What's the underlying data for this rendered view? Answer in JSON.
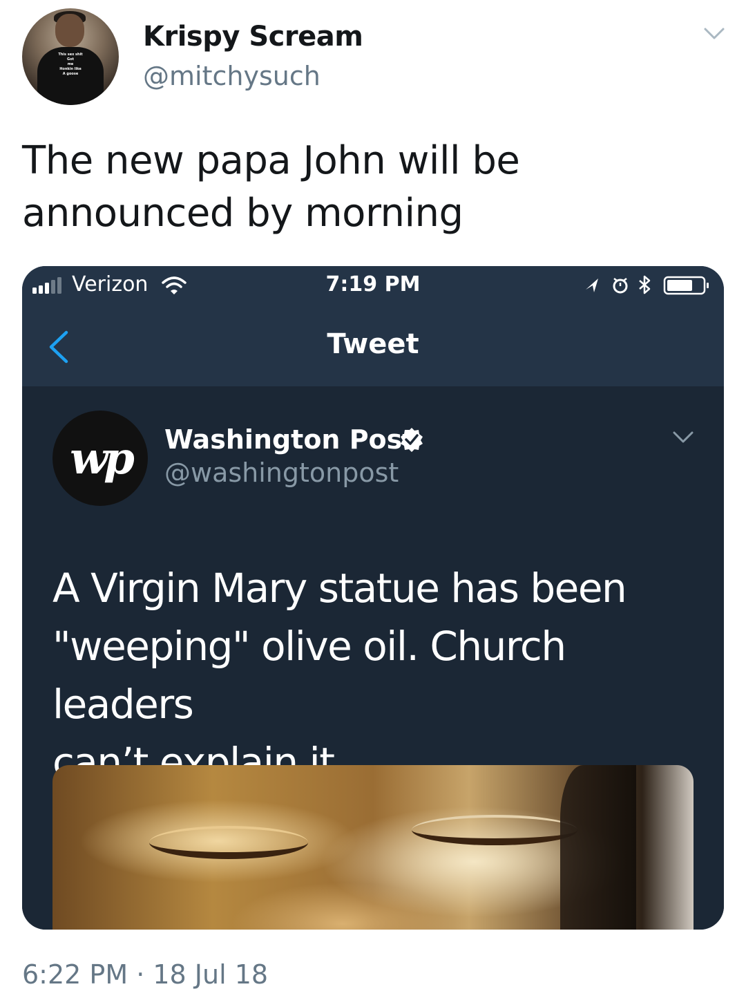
{
  "author": {
    "display_name": "Krispy Scream",
    "handle": "@mitchysuch",
    "avatar_shirt_text": [
      "This sex shit",
      "Got",
      "me",
      "Honkin like",
      "A goose"
    ]
  },
  "tweet": {
    "text_line1": "The new papa John will be",
    "text_line2": "announced by morning",
    "timestamp": "6:22 PM · 18 Jul 18"
  },
  "embedded_screenshot": {
    "status_bar": {
      "carrier": "Verizon",
      "time": "7:19 PM"
    },
    "nav": {
      "title": "Tweet"
    },
    "quoted_tweet": {
      "logo_text": "wp",
      "display_name": "Washington Post",
      "handle": "@washingtonpost",
      "text_line1": "A Virgin Mary statue has been",
      "text_line2": "\"weeping\" olive oil. Church leaders",
      "text_line3": "can’t explain it."
    }
  },
  "colors": {
    "accent": "#1da1f2",
    "dark_bg": "#1b2735",
    "dark_nav": "#243447",
    "muted_text": "#657786"
  }
}
